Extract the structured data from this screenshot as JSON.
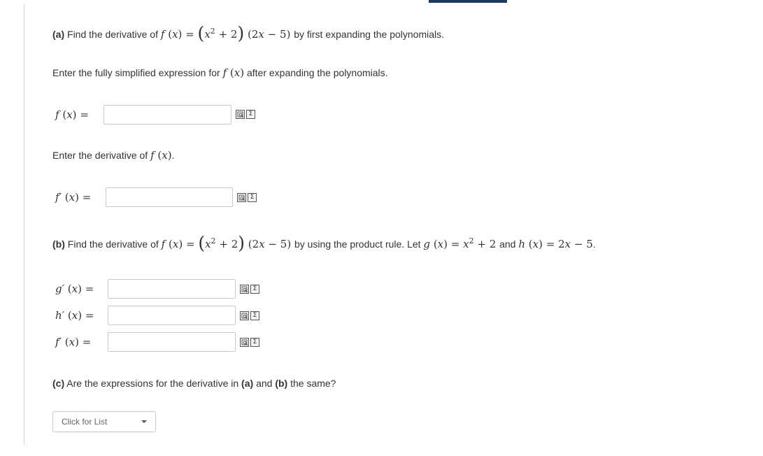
{
  "part_a": {
    "label": "(a)",
    "prompt_start": "Find the derivative of",
    "prompt_end": "by first expanding the polynomials.",
    "function_expr": {
      "f": "f",
      "x": "x",
      "eq": "=",
      "term1": "x",
      "exp": "2",
      "plus": "+",
      "const": "2",
      "term2_coef": "2",
      "term2_var": "x",
      "minus": "−",
      "term2_const": "5"
    },
    "instruction_1_start": "Enter the fully simplified expression for",
    "instruction_1_end": "after expanding the polynomials.",
    "instruction_2_start": "Enter the derivative of",
    "instruction_2_end": ".",
    "fx_label": "f",
    "fpx_label": "f′",
    "fx_value": "",
    "fpx_value": ""
  },
  "part_b": {
    "label": "(b)",
    "prompt_start": "Find the derivative of",
    "prompt_mid": "by using the product rule. Let",
    "and": "and",
    "end": ".",
    "g_label": "g′",
    "h_label": "h′",
    "f_label": "f′",
    "g_value": "",
    "h_value": "",
    "f_value": "",
    "g_def": {
      "g": "g",
      "x": "x",
      "term": "x",
      "exp": "2",
      "plus": "+",
      "const": "2"
    },
    "h_def": {
      "h": "h",
      "x": "x",
      "coef": "2",
      "var": "x",
      "minus": "−",
      "const": "5"
    }
  },
  "part_c": {
    "label": "(c)",
    "q_start": "Are the expressions for the derivative in",
    "a_ref": "(a)",
    "and": "and",
    "b_ref": "(b)",
    "q_end": "the same?",
    "dropdown_value": "Click for List"
  },
  "colors": {
    "accent_bar": "#1f3a5f",
    "input_border": "#c8c8c8",
    "text": "#333333"
  },
  "icons": [
    "preview-icon",
    "sigma-icon"
  ]
}
